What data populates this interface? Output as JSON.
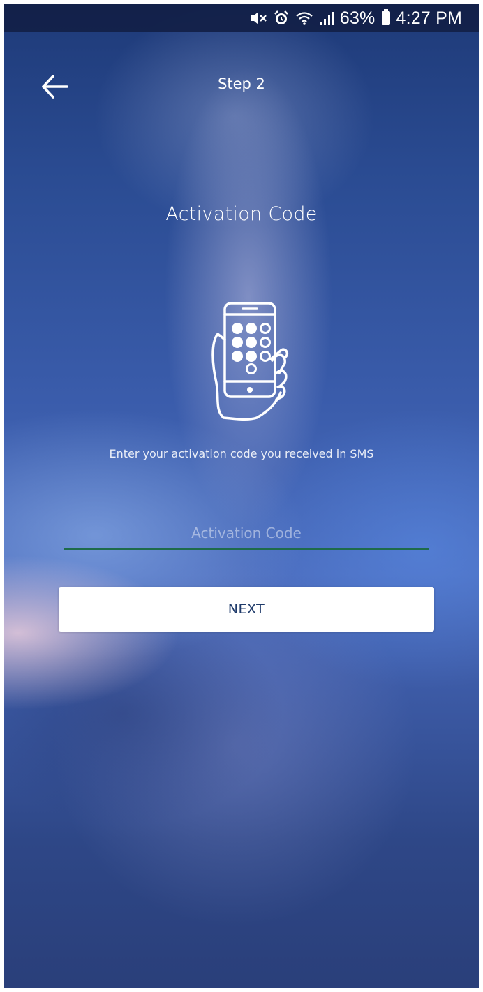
{
  "status_bar": {
    "battery_level": "63%",
    "time": "4:27 PM",
    "icons": [
      "mute-icon",
      "alarm-icon",
      "wifi-icon",
      "signal-icon",
      "battery-icon"
    ]
  },
  "header": {
    "back_icon": "arrow-left-icon",
    "step_label": "Step 2"
  },
  "main": {
    "title": "Activation Code",
    "illustration_icon": "phone-keypad-in-hand-icon",
    "instruction": "Enter your activation code you received in SMS",
    "code_input": {
      "value": "",
      "placeholder": "Activation Code"
    },
    "next_button_label": "NEXT"
  },
  "colors": {
    "input_underline": "#1e6b4a",
    "button_background": "#ffffff",
    "button_text": "#1e3a6a",
    "status_bar_background": "#122046"
  }
}
